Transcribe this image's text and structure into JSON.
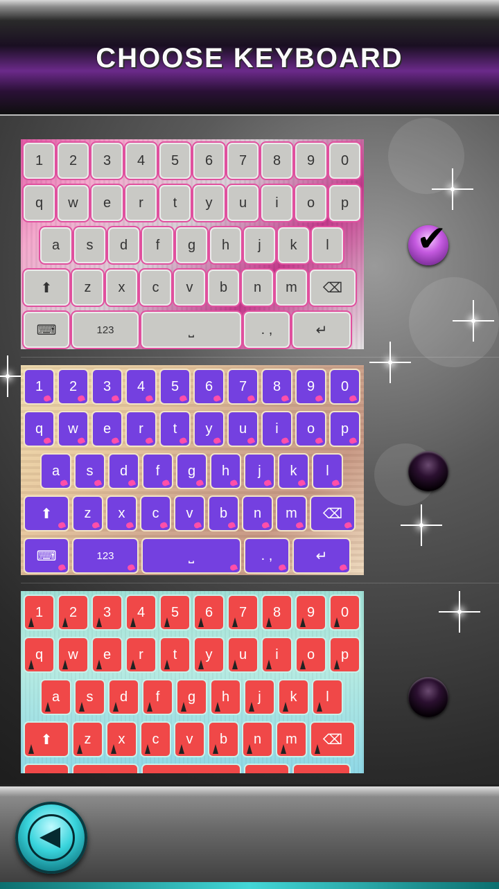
{
  "header": {
    "title": "CHOOSE KEYBOARD"
  },
  "keyboard_rows": {
    "numbers": [
      "1",
      "2",
      "3",
      "4",
      "5",
      "6",
      "7",
      "8",
      "9",
      "0"
    ],
    "top": [
      "q",
      "w",
      "e",
      "r",
      "t",
      "y",
      "u",
      "i",
      "o",
      "p"
    ],
    "middle": [
      "a",
      "s",
      "d",
      "f",
      "g",
      "h",
      "j",
      "k",
      "l"
    ],
    "bottom": [
      "z",
      "x",
      "c",
      "v",
      "b",
      "n",
      "m"
    ],
    "mode_key": "123",
    "space_key": "⎵",
    "punct_key": ". ,",
    "shift_key": "⬆",
    "delete_key": "⌫",
    "enter_key": "↵",
    "emoji_key": "⌨"
  },
  "themes": [
    {
      "selected": true,
      "accent": "#e0509e",
      "key_color": "#c9c9c5"
    },
    {
      "selected": false,
      "accent": "#ff4fa9",
      "key_color": "#7440e0"
    },
    {
      "selected": false,
      "accent": "#9fe0d6",
      "key_color": "#f04848"
    }
  ],
  "icons": {
    "selected_radio": "check-icon",
    "back": "back-arrow-icon"
  }
}
